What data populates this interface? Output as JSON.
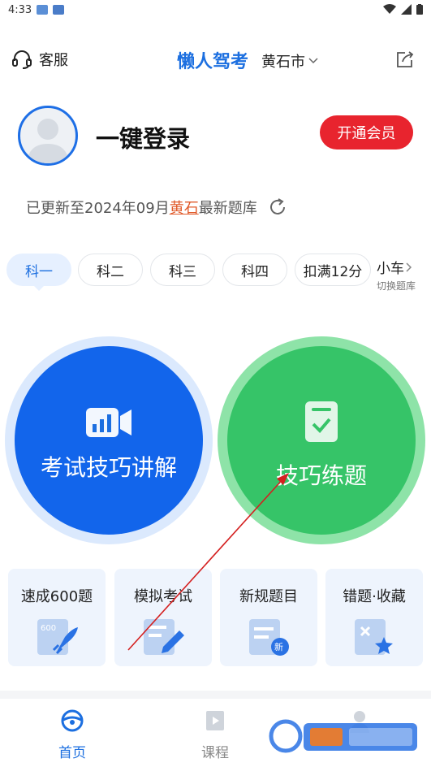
{
  "status_bar": {
    "time": "4:33"
  },
  "header": {
    "service_label": "客服",
    "app_title": "懒人驾考",
    "city": "黄石市"
  },
  "profile": {
    "login_text": "一键登录",
    "vip_button": "开通会员"
  },
  "update_notice": {
    "prefix": "已更新至2024年09月",
    "city": "黄石",
    "suffix": "最新题库"
  },
  "subject_tabs": [
    {
      "label": "科一",
      "active": true
    },
    {
      "label": "科二",
      "active": false
    },
    {
      "label": "科三",
      "active": false
    },
    {
      "label": "科四",
      "active": false
    },
    {
      "label": "扣满12分",
      "active": false
    }
  ],
  "car_switch": {
    "label": "小车",
    "hint": "切换题库"
  },
  "main_actions": {
    "left": {
      "label": "考试技巧讲解",
      "icon": "video-camera-icon",
      "color": "#1265eb"
    },
    "right": {
      "label": "技巧练题",
      "icon": "checklist-icon",
      "color": "#36c468"
    }
  },
  "feature_cards": [
    {
      "label": "速成600题",
      "icon": "rocket-600-icon",
      "badge": "600"
    },
    {
      "label": "模拟考试",
      "icon": "exam-pencil-icon"
    },
    {
      "label": "新规题目",
      "icon": "new-rules-icon",
      "badge": "新"
    },
    {
      "label": "错题·收藏",
      "icon": "wrong-favorite-icon"
    }
  ],
  "bottom_nav": [
    {
      "label": "首页",
      "icon": "steering-wheel-icon",
      "active": true
    },
    {
      "label": "课程",
      "icon": "course-play-icon",
      "active": false
    },
    {
      "label": "",
      "icon": "profile-icon",
      "active": false
    }
  ],
  "colors": {
    "primary": "#1c6fe0",
    "vip": "#e8242e",
    "green": "#36c468",
    "highlight": "#e05a2a"
  }
}
